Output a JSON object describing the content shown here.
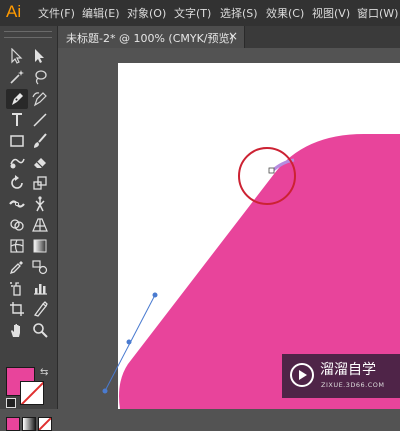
{
  "app": {
    "logo": "Ai"
  },
  "menu": [
    "文件(F)",
    "编辑(E)",
    "对象(O)",
    "文字(T)",
    "选择(S)",
    "效果(C)",
    "视图(V)",
    "窗口(W)"
  ],
  "document_tab": {
    "title": "未标题-2* @ 100% (CMYK/预览)",
    "close": "×"
  },
  "tools": [
    {
      "name": "selection-tool-icon"
    },
    {
      "name": "direct-selection-tool-icon"
    },
    {
      "name": "magic-wand-tool-icon"
    },
    {
      "name": "lasso-tool-icon"
    },
    {
      "name": "pen-tool-icon",
      "active": true
    },
    {
      "name": "curvature-tool-icon"
    },
    {
      "name": "type-tool-icon"
    },
    {
      "name": "line-segment-tool-icon"
    },
    {
      "name": "rectangle-tool-icon"
    },
    {
      "name": "paintbrush-tool-icon"
    },
    {
      "name": "shaper-tool-icon"
    },
    {
      "name": "eraser-tool-icon"
    },
    {
      "name": "rotate-tool-icon"
    },
    {
      "name": "scale-tool-icon"
    },
    {
      "name": "width-tool-icon"
    },
    {
      "name": "puppet-warp-tool-icon"
    },
    {
      "name": "shape-builder-tool-icon"
    },
    {
      "name": "perspective-grid-tool-icon"
    },
    {
      "name": "mesh-tool-icon"
    },
    {
      "name": "gradient-tool-icon"
    },
    {
      "name": "eyedropper-tool-icon"
    },
    {
      "name": "blend-tool-icon"
    },
    {
      "name": "symbol-sprayer-tool-icon"
    },
    {
      "name": "column-graph-tool-icon"
    },
    {
      "name": "artboard-tool-icon"
    },
    {
      "name": "slice-tool-icon"
    },
    {
      "name": "hand-tool-icon"
    },
    {
      "name": "zoom-tool-icon"
    }
  ],
  "colors": {
    "fill": "#e8449b",
    "stroke": "none",
    "anchor_highlight": "#cc2233",
    "handle": "#4a7bd0"
  },
  "watermark": {
    "title": "溜溜自学",
    "url": "ZIXUE.3D66.COM"
  }
}
